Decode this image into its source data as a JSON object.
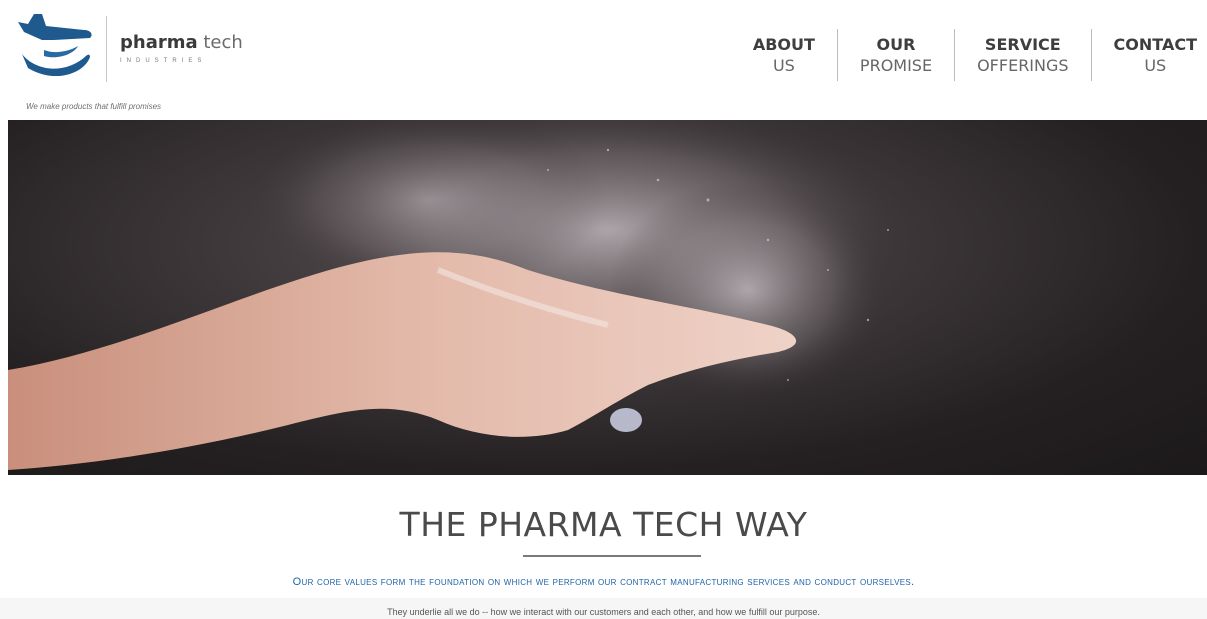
{
  "header": {
    "brand": {
      "name_bold": "pharma",
      "name_light": "tech",
      "sub": "INDUSTRIES"
    },
    "tagline": "We make products that fulfill promises",
    "nav": [
      {
        "line1": "ABOUT",
        "line2": "US"
      },
      {
        "line1": "OUR",
        "line2": "PROMISE"
      },
      {
        "line1": "SERVICE",
        "line2": "OFFERINGS"
      },
      {
        "line1": "CONTACT",
        "line2": "US"
      }
    ]
  },
  "section": {
    "title": "THE PHARMA TECH WAY",
    "values": "Our core values form the foundation on which we perform our contract manufacturing services and conduct ourselves.",
    "underlie": "They underlie all we do -- how we interact with our customers and each other, and how we fulfill our purpose."
  },
  "colors": {
    "brand_blue": "#1e64a8",
    "logo_blue": "#1f5a8f",
    "hero_bg": "#242022"
  }
}
